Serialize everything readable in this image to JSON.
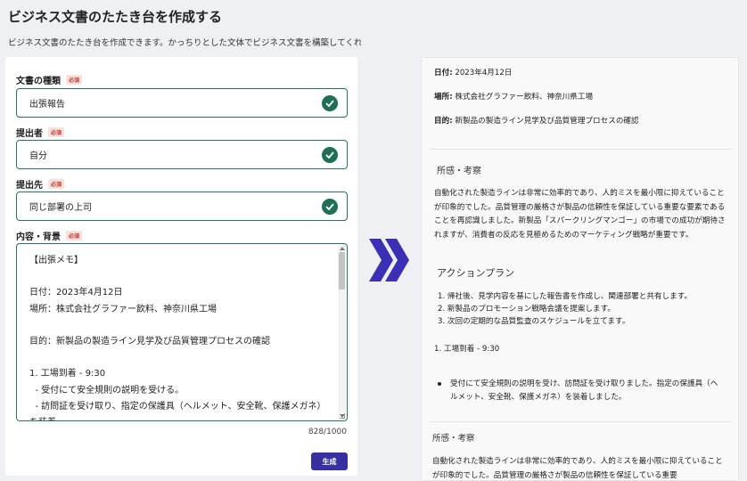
{
  "page": {
    "title": "ビジネス文書のたたき台を作成する",
    "description": "ビジネス文書のたたき台を作成できます。かっちりとした文体でビジネス文書を構築してくれ"
  },
  "form": {
    "required_badge": "必須",
    "doc_type": {
      "label": "文書の種類",
      "value": "出張報告"
    },
    "submitter": {
      "label": "提出者",
      "value": "自分"
    },
    "recipient": {
      "label": "提出先",
      "value": "同じ部署の上司"
    },
    "content": {
      "label": "内容・背景",
      "value": "【出張メモ】\n\n日付：2023年4月12日\n場所：株式会社グラファー飲料、神奈川県工場\n\n目的：新製品の製造ライン見学及び品質管理プロセスの確認\n\n1. 工場到着 - 9:30\n  - 受付にて安全規則の説明を受ける。\n  - 訪問証を受け取り、指定の保護具（ヘルメット、安全靴、保護メガネ）を装着。",
      "char_count": "828/1000"
    },
    "generate_label": "生成"
  },
  "output": {
    "date_key": "日付:",
    "date_val": " 2023年4月12日",
    "place_key": "場所:",
    "place_val": " 株式会社グラファー飲料、神奈川県工場",
    "purpose_key": "目的:",
    "purpose_val": " 新製品の製造ライン見学及び品質管理プロセスの確認",
    "heading_impressions": "所感・考察",
    "impressions_text": "自動化された製造ラインは非常に効率的であり、人的ミスを最小限に抑えていることが印象的でした。品質管理の厳格さが製品の信頼性を保証している重要な要素であることを再認識しました。新製品「スパークリングマンゴー」の市場での成功が期待されますが、消費者の反応を見極めるためのマーケティング戦略が重要です。",
    "heading_action": "アクションプラン",
    "action_items": [
      "1. 帰社後、見学内容を基にした報告書を作成し、関連部署と共有します。",
      "2. 新製品のプロモーション戦略会議を提案します。",
      "3. 次回の定期的な品質監査のスケジュールを立てます。"
    ],
    "arrival": "1. 工場到着 - 9:30",
    "bullet_item": "受付にて安全規則の説明を受け、訪問証を受け取りました。指定の保護具（ヘルメット、安全靴、保護メガネ）を装着しました。",
    "heading_impressions_2": "所感・考察",
    "impressions_text_2": "自動化された製造ラインは非常に効率的であり、人的ミスを最小限に抑えていることが印象的でした。品質管理の厳格さが製品の信頼性を保証している重要"
  },
  "colors": {
    "accent": "#3730a3",
    "valid_border": "#1f7a5a",
    "check_fill": "#1f6f52",
    "required_badge": "#c0392b"
  },
  "icons": [
    "check-circle-icon",
    "double-chevron-right-icon"
  ]
}
